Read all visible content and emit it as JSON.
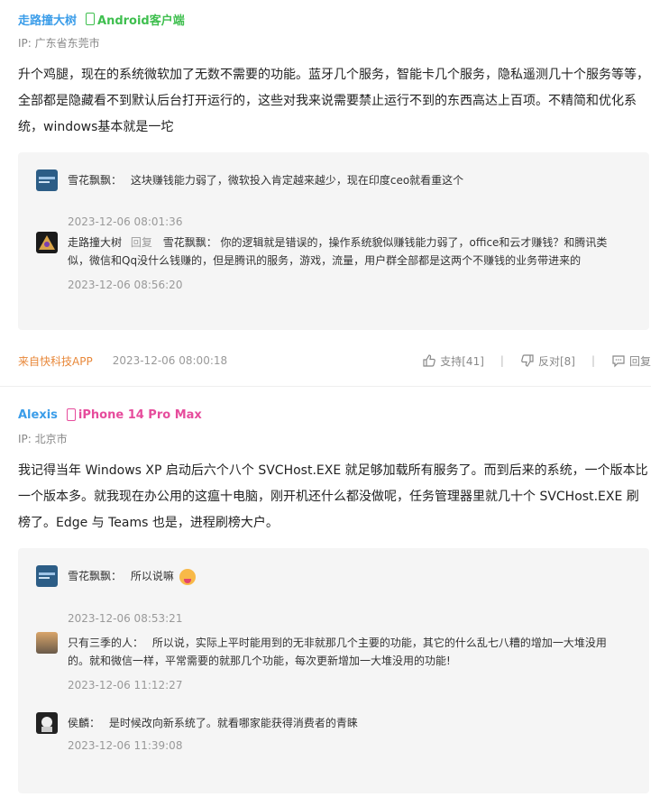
{
  "comments": [
    {
      "username": "走路撞大树",
      "device": "Android客户端",
      "device_color": "#3fbf4f",
      "ip": "IP: 广东省东莞市",
      "content": "升个鸡腿，现在的系统微软加了无数不需要的功能。蓝牙几个服务，智能卡几个服务，隐私遥测几十个服务等等，全部都是隐藏看不到默认后台打开运行的，这些对我来说需要禁止运行不到的东西高达上百项。不精简和优化系统，windows基本就是一坨",
      "replies": [
        {
          "name": "雪花飘飘：",
          "text": "这块赚钱能力弱了，微软投入肯定越来越少，现在印度ceo就看重这个",
          "time": "2023-12-06 08:01:36"
        },
        {
          "name": "走路撞大树",
          "reply_word": "回复",
          "text": "雪花飘飘： 你的逻辑就是错误的，操作系统貌似赚钱能力弱了，office和云才赚钱？和腾讯类似，微信和Qq没什么钱赚的，但是腾讯的服务，游戏，流量，用户群全部都是这两个不赚钱的业务带进来的",
          "time": "2023-12-06 08:56:20"
        }
      ],
      "source": "来自快科技APP",
      "time": "2023-12-06 08:00:18",
      "support_label": "支持[41]",
      "oppose_label": "反对[8]",
      "reply_label": "回复"
    },
    {
      "username": "Alexis",
      "device": "iPhone 14 Pro Max",
      "device_color": "#e64c9c",
      "ip": "IP: 北京市",
      "content": "我记得当年 Windows XP 启动后六个八个 SVCHost.EXE 就足够加载所有服务了。而到后来的系统，一个版本比一个版本多。就我现在办公用的这瘟十电脑，刚开机还什么都没做呢，任务管理器里就几十个 SVCHost.EXE 刷榜了。Edge 与 Teams 也是，进程刷榜大户。",
      "replies": [
        {
          "name": "雪花飘飘：",
          "text": "所以说嘛",
          "time": "2023-12-06 08:53:21"
        },
        {
          "name": "只有三季的人：",
          "text": "所以说，实际上平时能用到的无非就那几个主要的功能，其它的什么乱七八糟的增加一大堆没用的。就和微信一样，平常需要的就那几个功能，每次更新增加一大堆没用的功能!",
          "time": "2023-12-06 11:12:27"
        },
        {
          "name": "侯麟：",
          "text": "是时候改向新系统了。就看哪家能获得消费者的青睐",
          "time": "2023-12-06 11:39:08"
        }
      ]
    }
  ]
}
